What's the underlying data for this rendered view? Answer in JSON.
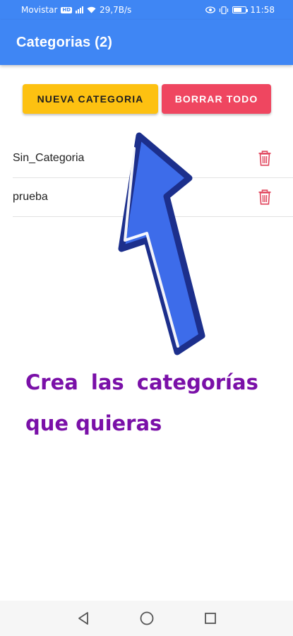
{
  "status_bar": {
    "carrier": "Movistar",
    "network_badge": "HD",
    "speed": "29,7B/s",
    "time": "11:58",
    "icons": [
      "signal-icon",
      "wifi-icon",
      "eye-icon",
      "vibrate-icon",
      "battery-icon"
    ]
  },
  "app_bar": {
    "title": "Categorias (2)",
    "color": "#3f86f4"
  },
  "buttons": {
    "new_category": "NUEVA CATEGORIA",
    "delete_all": "BORRAR TODO",
    "new_color": "#fdc111",
    "delete_color": "#ef4660"
  },
  "categories": [
    {
      "name": "Sin_Categoria",
      "icon": "trash-icon"
    },
    {
      "name": "prueba",
      "icon": "trash-icon"
    }
  ],
  "promo": {
    "line1": "Crea las categorías",
    "line2": "que quieras",
    "color": "#7a10a8"
  },
  "nav": {
    "icons": [
      "back-icon",
      "home-icon",
      "recents-icon"
    ]
  }
}
